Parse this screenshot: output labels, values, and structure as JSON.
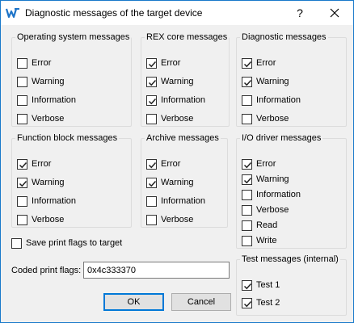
{
  "window": {
    "title": "Diagnostic messages of the target device",
    "help_label": "?",
    "icons": {
      "app": "rex-logo-icon",
      "close": "close-icon"
    }
  },
  "groups": [
    {
      "id": "os",
      "title": "Operating system messages",
      "items": [
        {
          "label": "Error",
          "checked": false
        },
        {
          "label": "Warning",
          "checked": false
        },
        {
          "label": "Information",
          "checked": false
        },
        {
          "label": "Verbose",
          "checked": false
        }
      ]
    },
    {
      "id": "rex-core",
      "title": "REX core messages",
      "items": [
        {
          "label": "Error",
          "checked": true
        },
        {
          "label": "Warning",
          "checked": true
        },
        {
          "label": "Information",
          "checked": true
        },
        {
          "label": "Verbose",
          "checked": false
        }
      ]
    },
    {
      "id": "diagnostic",
      "title": "Diagnostic messages",
      "items": [
        {
          "label": "Error",
          "checked": true
        },
        {
          "label": "Warning",
          "checked": true
        },
        {
          "label": "Information",
          "checked": false
        },
        {
          "label": "Verbose",
          "checked": false
        }
      ]
    },
    {
      "id": "function-block",
      "title": "Function block messages",
      "items": [
        {
          "label": "Error",
          "checked": true
        },
        {
          "label": "Warning",
          "checked": true
        },
        {
          "label": "Information",
          "checked": false
        },
        {
          "label": "Verbose",
          "checked": false
        }
      ]
    },
    {
      "id": "archive",
      "title": "Archive messages",
      "items": [
        {
          "label": "Error",
          "checked": true
        },
        {
          "label": "Warning",
          "checked": true
        },
        {
          "label": "Information",
          "checked": false
        },
        {
          "label": "Verbose",
          "checked": false
        }
      ]
    },
    {
      "id": "io-driver",
      "title": "I/O driver messages",
      "items": [
        {
          "label": "Error",
          "checked": true
        },
        {
          "label": "Warning",
          "checked": true
        },
        {
          "label": "Information",
          "checked": false
        },
        {
          "label": "Verbose",
          "checked": false
        },
        {
          "label": "Read",
          "checked": false
        },
        {
          "label": "Write",
          "checked": false
        }
      ]
    },
    {
      "id": "test",
      "title": "Test messages (internal)",
      "items": [
        {
          "label": "Test 1",
          "checked": true
        },
        {
          "label": "Test 2",
          "checked": true
        }
      ]
    }
  ],
  "save_flags": {
    "label": "Save print flags to target",
    "checked": false
  },
  "coded_flags": {
    "label": "Coded print flags:",
    "value": "0x4c333370"
  },
  "buttons": {
    "ok": "OK",
    "cancel": "Cancel"
  },
  "colors": {
    "accent": "#0078d7",
    "window_border": "#1979ca",
    "background": "#f0f0f0"
  }
}
